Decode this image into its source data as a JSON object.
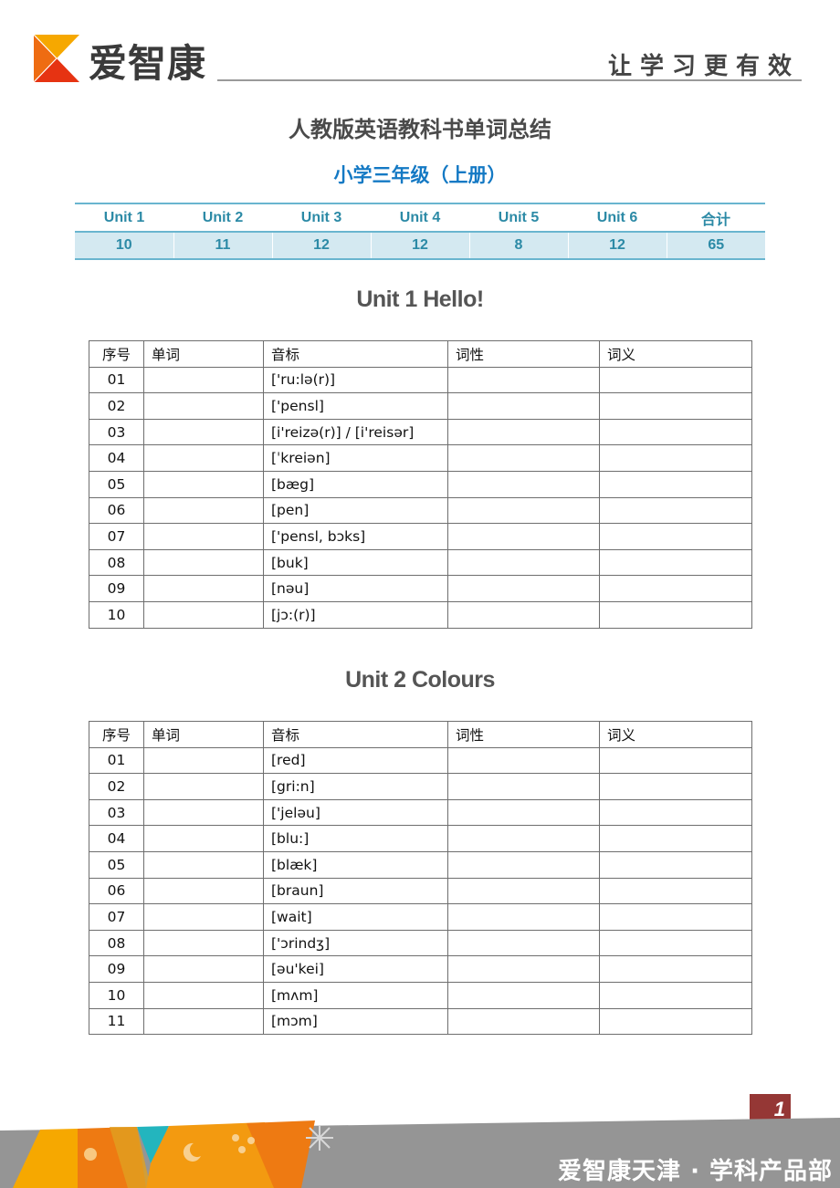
{
  "header": {
    "brand_name": "爱智康",
    "slogan": "让学习更有效",
    "brand_colors": {
      "top": "#f6a800",
      "left": "#ee6c12",
      "bottom": "#e63312"
    }
  },
  "document": {
    "title": "人教版英语教科书单词总结",
    "subtitle": "小学三年级（上册）"
  },
  "summary": {
    "headers": [
      "Unit 1",
      "Unit 2",
      "Unit 3",
      "Unit 4",
      "Unit 5",
      "Unit 6",
      "合计"
    ],
    "counts": [
      "10",
      "11",
      "12",
      "12",
      "8",
      "12",
      "65"
    ]
  },
  "units": [
    {
      "title": "Unit 1 Hello!",
      "columns": [
        "序号",
        "单词",
        "音标",
        "词性",
        "词义"
      ],
      "rows": [
        {
          "no": "01",
          "word": "",
          "phonetic": "['ru:lə(r)]",
          "pos": "",
          "meaning": ""
        },
        {
          "no": "02",
          "word": "",
          "phonetic": "['pensl]",
          "pos": "",
          "meaning": ""
        },
        {
          "no": "03",
          "word": "",
          "phonetic": "[i'reizə(r)] / [i'reisər]",
          "pos": "",
          "meaning": ""
        },
        {
          "no": "04",
          "word": "",
          "phonetic": "[ˈkreiən]",
          "pos": "",
          "meaning": ""
        },
        {
          "no": "05",
          "word": "",
          "phonetic": "[bæg]",
          "pos": "",
          "meaning": ""
        },
        {
          "no": "06",
          "word": "",
          "phonetic": "[pen]",
          "pos": "",
          "meaning": ""
        },
        {
          "no": "07",
          "word": "",
          "phonetic": "['pensl, bɔks]",
          "pos": "",
          "meaning": ""
        },
        {
          "no": "08",
          "word": "",
          "phonetic": "[buk]",
          "pos": "",
          "meaning": ""
        },
        {
          "no": "09",
          "word": "",
          "phonetic": "[nəu]",
          "pos": "",
          "meaning": ""
        },
        {
          "no": "10",
          "word": "",
          "phonetic": "[jɔ:(r)]",
          "pos": "",
          "meaning": ""
        }
      ]
    },
    {
      "title": "Unit 2 Colours",
      "columns": [
        "序号",
        "单词",
        "音标",
        "词性",
        "词义"
      ],
      "rows": [
        {
          "no": "01",
          "word": "",
          "phonetic": "[red]",
          "pos": "",
          "meaning": ""
        },
        {
          "no": "02",
          "word": "",
          "phonetic": "[gri:n]",
          "pos": "",
          "meaning": ""
        },
        {
          "no": "03",
          "word": "",
          "phonetic": "['jeləu]",
          "pos": "",
          "meaning": ""
        },
        {
          "no": "04",
          "word": "",
          "phonetic": "[blu:]",
          "pos": "",
          "meaning": ""
        },
        {
          "no": "05",
          "word": "",
          "phonetic": "[blæk]",
          "pos": "",
          "meaning": ""
        },
        {
          "no": "06",
          "word": "",
          "phonetic": "[braun]",
          "pos": "",
          "meaning": ""
        },
        {
          "no": "07",
          "word": "",
          "phonetic": "[wait]",
          "pos": "",
          "meaning": ""
        },
        {
          "no": "08",
          "word": "",
          "phonetic": "['ɔrindʒ]",
          "pos": "",
          "meaning": ""
        },
        {
          "no": "09",
          "word": "",
          "phonetic": "[əu'kei]",
          "pos": "",
          "meaning": ""
        },
        {
          "no": "10",
          "word": "",
          "phonetic": "[mʌm]",
          "pos": "",
          "meaning": ""
        },
        {
          "no": "11",
          "word": "",
          "phonetic": "[mɔm]",
          "pos": "",
          "meaning": ""
        }
      ]
    }
  ],
  "footer": {
    "page_number": "1",
    "org_text": "爱智康天津 · 学科产品部",
    "page_badge_color": "#953735",
    "band_color": "#959595"
  }
}
